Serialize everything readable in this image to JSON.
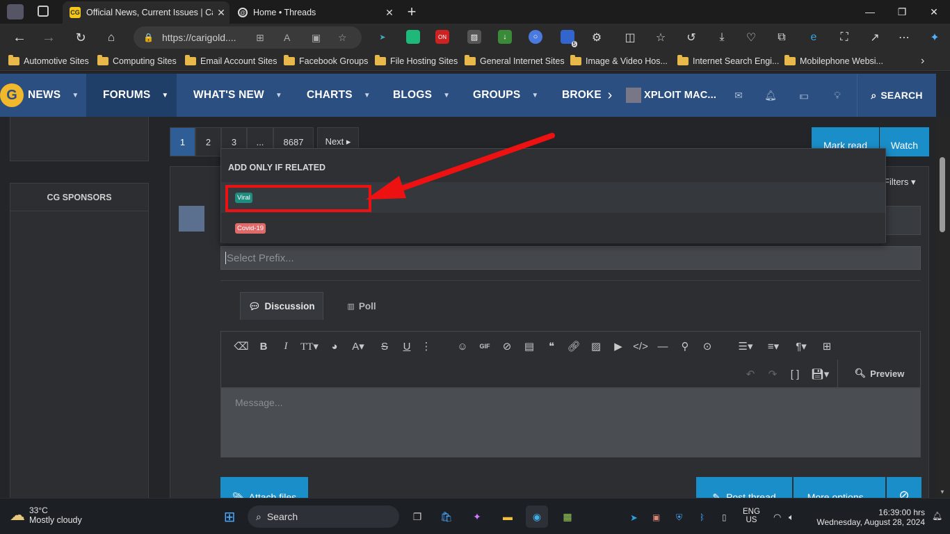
{
  "browser": {
    "tabs": [
      {
        "title": "Official News, Current Issues | Car",
        "favicon": "CG"
      },
      {
        "title": "Home • Threads",
        "favicon": "threads-icon"
      }
    ],
    "url": "https://carigold....",
    "bookmarks": [
      "Automotive Sites",
      "Computing Sites",
      "Email Account Sites",
      "Facebook Groups",
      "File Hosting Sites",
      "General Internet Sites",
      "Image & Video Hos...",
      "Internet Search Engi...",
      "Mobilephone Websi..."
    ],
    "extension_badge": "5"
  },
  "site": {
    "nav": [
      "NEWS",
      "FORUMS",
      "WHAT'S NEW",
      "CHARTS",
      "BLOGS",
      "GROUPS",
      "BROKE"
    ],
    "user": "XPLOIT MAC...",
    "search_label": "SEARCH",
    "sidebar_title": "CG SPONSORS",
    "pagination": [
      "1",
      "2",
      "3",
      "...",
      "8687",
      "Next ▸"
    ],
    "mark_read": "Mark read",
    "watch": "Watch",
    "filters": "Filters ▾"
  },
  "dropdown": {
    "header": "ADD ONLY IF RELATED",
    "options": [
      {
        "label": "Viral",
        "color": "#1e8c7e"
      },
      {
        "label": "Covid-19",
        "color": "#e06a6a"
      }
    ]
  },
  "editor": {
    "prefix_placeholder": "Select Prefix...",
    "tab_discussion": "Discussion",
    "tab_poll": "Poll",
    "message_placeholder": "Message...",
    "preview": "Preview",
    "attach_files": "Attach files",
    "post_thread": "Post thread",
    "more_options": "More options..."
  },
  "taskbar": {
    "temp": "33°C",
    "weather": "Mostly cloudy",
    "search": "Search",
    "lang1": "ENG",
    "lang2": "US",
    "time": "16:39:00 hrs",
    "date": "Wednesday, August 28, 2024"
  },
  "colors": {
    "accent_blue": "#1a8ec8",
    "annotation_red": "#ee1111",
    "nav_blue": "#2b4f80"
  }
}
